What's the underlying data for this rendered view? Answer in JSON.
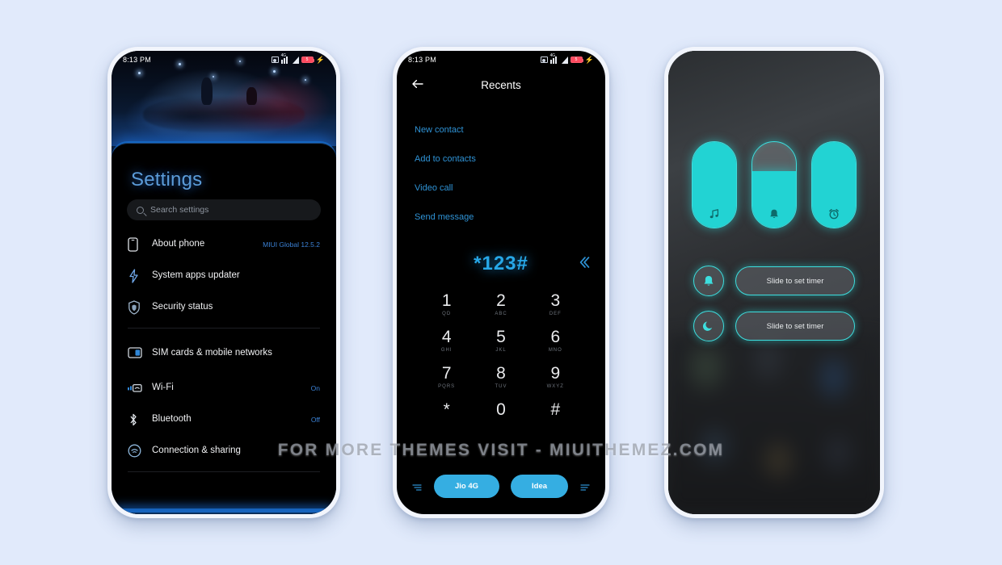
{
  "watermark": "FOR MORE THEMES VISIT - MIUITHEMEZ.COM",
  "theme": {
    "page_background": "#e1eafb",
    "accent_blue": "#3b82d6",
    "accent_cyan": "#22d3d3",
    "dialer_blue": "#35aee2"
  },
  "phone1": {
    "name": "settings-screen",
    "statusbar": {
      "time": "8:13 PM",
      "network": "4G",
      "battery_level": "low",
      "charging": true
    },
    "title": "Settings",
    "search": {
      "placeholder": "Search settings"
    },
    "items": [
      {
        "icon": "phone-icon",
        "label": "About phone",
        "value": "MIUI Global 12.5.2"
      },
      {
        "icon": "updater-icon",
        "label": "System apps updater",
        "value": ""
      },
      {
        "icon": "shield-icon",
        "label": "Security status",
        "value": ""
      },
      {
        "icon": "sim-card-icon",
        "label": "SIM cards & mobile networks",
        "value": ""
      },
      {
        "icon": "wifi-icon",
        "label": "Wi-Fi",
        "value": "On"
      },
      {
        "icon": "bluetooth-icon",
        "label": "Bluetooth",
        "value": "Off"
      },
      {
        "icon": "connection-icon",
        "label": "Connection & sharing",
        "value": ""
      }
    ]
  },
  "phone2": {
    "name": "dialer-screen",
    "statusbar": {
      "time": "8:13 PM",
      "network": "4G",
      "battery_level": "low",
      "charging": true
    },
    "back_icon": "arrow-left-icon",
    "title": "Recents",
    "actions": [
      {
        "label": "New contact"
      },
      {
        "label": "Add to contacts"
      },
      {
        "label": "Video call"
      },
      {
        "label": "Send message"
      }
    ],
    "number": "*123#",
    "backspace_icon": "backspace-chevron-icon",
    "keypad": [
      [
        {
          "digit": "1",
          "sub": "QD"
        },
        {
          "digit": "2",
          "sub": "ABC"
        },
        {
          "digit": "3",
          "sub": "DEF"
        }
      ],
      [
        {
          "digit": "4",
          "sub": "GHI"
        },
        {
          "digit": "5",
          "sub": "JKL"
        },
        {
          "digit": "6",
          "sub": "MNO"
        }
      ],
      [
        {
          "digit": "7",
          "sub": "PQRS"
        },
        {
          "digit": "8",
          "sub": "TUV"
        },
        {
          "digit": "9",
          "sub": "WXYZ"
        }
      ],
      [
        {
          "digit": "*",
          "sub": ""
        },
        {
          "digit": "0",
          "sub": ""
        },
        {
          "digit": "#",
          "sub": ""
        }
      ]
    ],
    "sim_buttons": [
      {
        "label": "Jio 4G"
      },
      {
        "label": "Idea"
      }
    ]
  },
  "phone3": {
    "name": "volume-timer-screen",
    "sliders": [
      {
        "icon": "music-note-icon",
        "level_percent": 100
      },
      {
        "icon": "bell-icon",
        "level_percent": 66
      },
      {
        "icon": "alarm-clock-icon",
        "level_percent": 100
      }
    ],
    "timers": [
      {
        "icon": "bell-icon",
        "label": "Slide to set timer"
      },
      {
        "icon": "moon-icon",
        "label": "Slide to set timer"
      }
    ]
  }
}
